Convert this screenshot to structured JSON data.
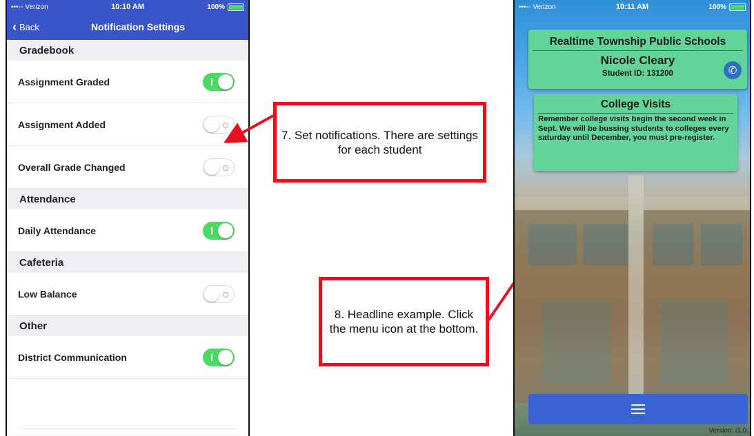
{
  "left_phone": {
    "status_bar": {
      "carrier": "•••◦◦ Verizon",
      "time": "10:10 AM",
      "battery": "100%"
    },
    "nav": {
      "back_label": "Back",
      "title": "Notification Settings"
    },
    "sections": [
      {
        "header": "Gradebook",
        "rows": [
          {
            "label": "Assignment Graded",
            "on": true
          },
          {
            "label": "Assignment Added",
            "on": false
          },
          {
            "label": "Overall Grade Changed",
            "on": false
          }
        ]
      },
      {
        "header": "Attendance",
        "rows": [
          {
            "label": "Daily Attendance",
            "on": true
          }
        ]
      },
      {
        "header": "Cafeteria",
        "rows": [
          {
            "label": "Low Balance",
            "on": false
          }
        ]
      },
      {
        "header": "Other",
        "rows": [
          {
            "label": "District Communication",
            "on": true
          }
        ]
      }
    ]
  },
  "callouts": {
    "one": "7. Set notifications. There are settings for each student",
    "two": "8. Headline example. Click the menu icon at the bottom."
  },
  "right_phone": {
    "status_bar": {
      "carrier": "•••◦◦ Verizon",
      "time": "10:11 AM",
      "battery": "100%"
    },
    "school_name": "Realtime Township Public Schools",
    "student_name": "Nicole Cleary",
    "student_id": "Student ID: 131200",
    "headline": {
      "title": "College Visits",
      "body": "Remember college visits begin the second week in Sept. We will be bussing students to colleges every saturday until December, you must pre-register."
    },
    "version": "Version: i1.0."
  },
  "colors": {
    "ios_blue": "#3a55c9",
    "toggle_on": "#4cd964",
    "card_green": "#62d49a",
    "callout_red": "#e8101c"
  }
}
